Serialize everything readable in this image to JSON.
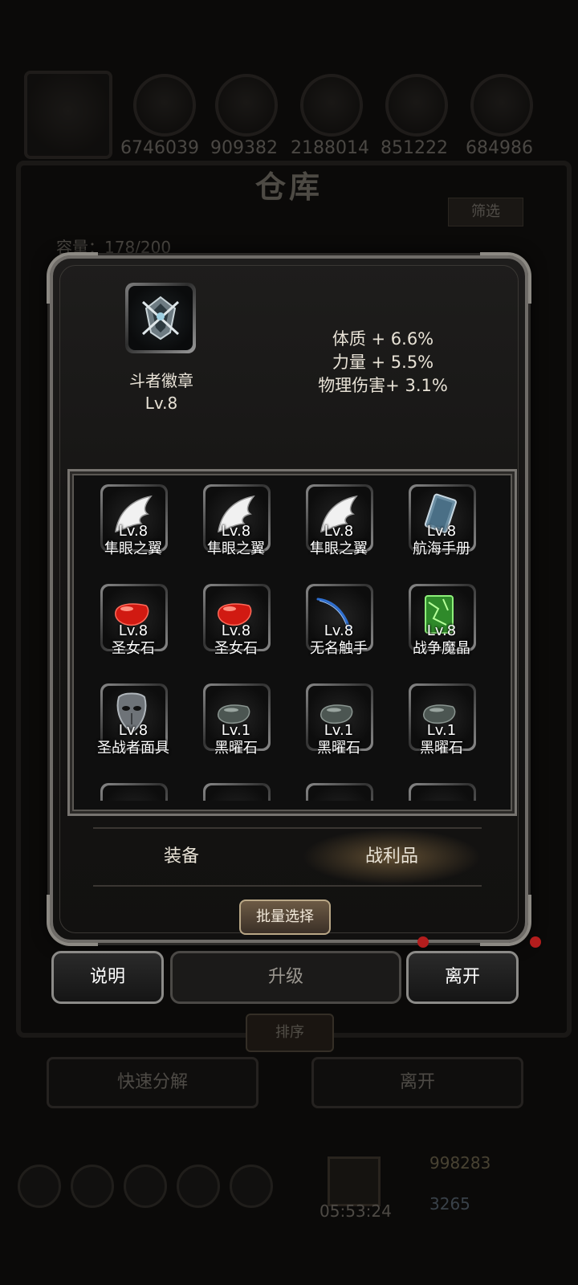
{
  "background": {
    "resources": [
      "6746039",
      "909382",
      "2188014",
      "851222",
      "684986"
    ],
    "title": "仓库",
    "filter_label": "筛选",
    "capacity_label": "容量：178/200",
    "sort_label": "排序",
    "quick_dismantle_label": "快速分解",
    "leave_label": "离开",
    "gold": "998283",
    "gems": "3265",
    "timer": "05:53:24"
  },
  "detail": {
    "name": "斗者徽章",
    "level": "Lv.8",
    "stats": [
      "体质 + 6.6%",
      "力量 + 5.5%",
      "物理伤害+ 3.1%"
    ]
  },
  "grid": {
    "items": [
      {
        "icon": "wing-icon",
        "level": "Lv.8",
        "name": "隼眼之翼"
      },
      {
        "icon": "wing-icon",
        "level": "Lv.8",
        "name": "隼眼之翼"
      },
      {
        "icon": "wing-icon",
        "level": "Lv.8",
        "name": "隼眼之翼"
      },
      {
        "icon": "book-icon",
        "level": "Lv.8",
        "name": "航海手册"
      },
      {
        "icon": "red-stone-icon",
        "level": "Lv.8",
        "name": "圣女石"
      },
      {
        "icon": "red-stone-icon",
        "level": "Lv.8",
        "name": "圣女石"
      },
      {
        "icon": "tentacle-icon",
        "level": "Lv.8",
        "name": "无名触手"
      },
      {
        "icon": "green-crystal-icon",
        "level": "Lv.8",
        "name": "战争魔晶"
      },
      {
        "icon": "mask-icon",
        "level": "Lv.8",
        "name": "圣战者面具"
      },
      {
        "icon": "obsidian-icon",
        "level": "Lv.1",
        "name": "黑曜石"
      },
      {
        "icon": "obsidian-icon",
        "level": "Lv.1",
        "name": "黑曜石"
      },
      {
        "icon": "obsidian-icon",
        "level": "Lv.1",
        "name": "黑曜石"
      }
    ]
  },
  "tabs": {
    "equipment": "装备",
    "loot": "战利品"
  },
  "batch_select_label": "批量选择",
  "actions": {
    "info": "说明",
    "upgrade": "升级",
    "leave": "离开"
  },
  "colors": {
    "accent_gold": "#b9a786",
    "notification_red": "#b31d1d"
  }
}
